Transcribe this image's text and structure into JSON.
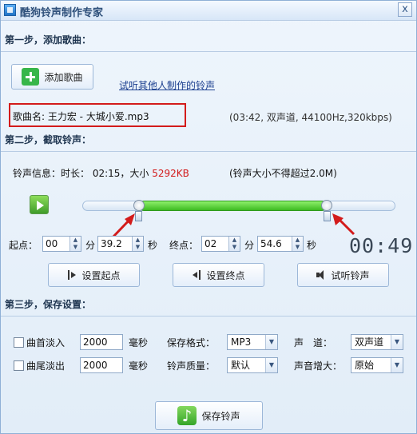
{
  "window": {
    "title": "酷狗铃声制作专家",
    "close_label": "x"
  },
  "step1": {
    "title": "第一步，添加歌曲：",
    "add_button": "添加歌曲",
    "preview_link": "试听其他人制作的铃声",
    "song_name": "歌曲名: 王力宏 - 大城小爱.mp3",
    "song_meta": "(03:42, 双声道, 44100Hz,320kbps)"
  },
  "step2": {
    "title": "第二步，截取铃声：",
    "info_prefix": "铃声信息：时长： 02:15，大小",
    "info_size": "5292KB",
    "info_note": "(铃声大小不得超过2.0M)",
    "start_label": "起点：",
    "start_min": "00",
    "min_unit": "分",
    "start_sec": "39.2",
    "sec_unit": "秒",
    "end_label": "终点：",
    "end_min": "02",
    "end_sec": "54.6",
    "lcd_time": "00:49",
    "set_start_button": "设置起点",
    "set_end_button": "设置终点",
    "preview_button": "试听铃声",
    "selection": {
      "start_fraction": 0.18,
      "end_fraction": 0.78
    }
  },
  "step3": {
    "title": "第三步，保存设置：",
    "fade_in_label": "曲首淡入",
    "fade_in_value": "2000",
    "fade_out_label": "曲尾淡出",
    "fade_out_value": "2000",
    "ms_unit": "毫秒",
    "format_label": "保存格式：",
    "format_value": "MP3",
    "quality_label": "铃声质量：",
    "quality_value": "默认",
    "channel_label": "声　道：",
    "channel_value": "双声道",
    "volume_label": "声音增大：",
    "volume_value": "原始",
    "save_button": "保存铃声"
  },
  "colors": {
    "accent_green": "#37b64a",
    "highlight_red": "#d31b1b"
  }
}
